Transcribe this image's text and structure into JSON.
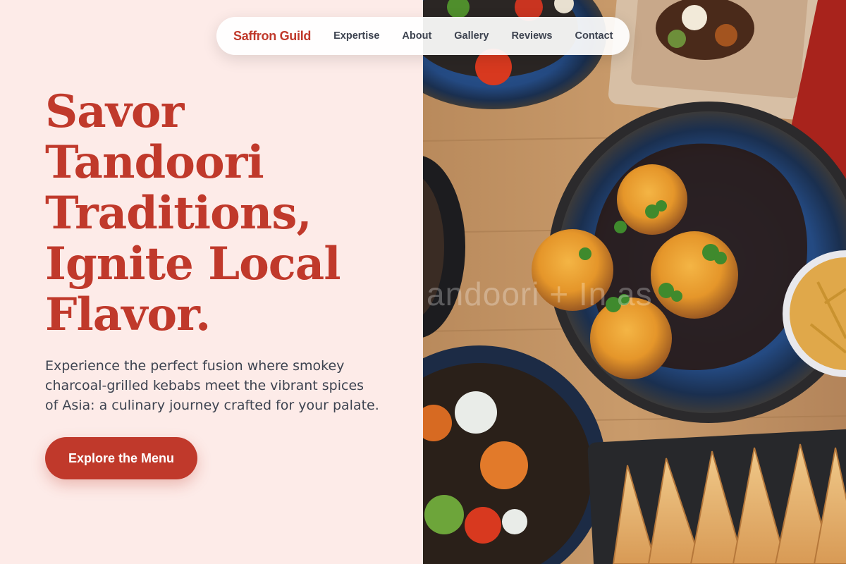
{
  "nav": {
    "brand": "Saffron Guild",
    "links": [
      "Expertise",
      "About",
      "Gallery",
      "Reviews",
      "Contact"
    ]
  },
  "hero": {
    "headline_lines": [
      "Savor",
      "Tandoori",
      "Traditions,",
      "Ignite Local",
      "Flavor."
    ],
    "subtext_lines": [
      "Experience the perfect fusion where smokey",
      "charcoal-grilled kebabs meet the vibrant spices",
      "of Asia: a culinary journey crafted for your palate."
    ],
    "cta_label": "Explore the Menu"
  },
  "image": {
    "watermark": "andoori + In    as",
    "subject": "food-photo"
  },
  "colors": {
    "accent": "#c0392b",
    "background": "#fdebe8",
    "text": "#3d4350"
  }
}
